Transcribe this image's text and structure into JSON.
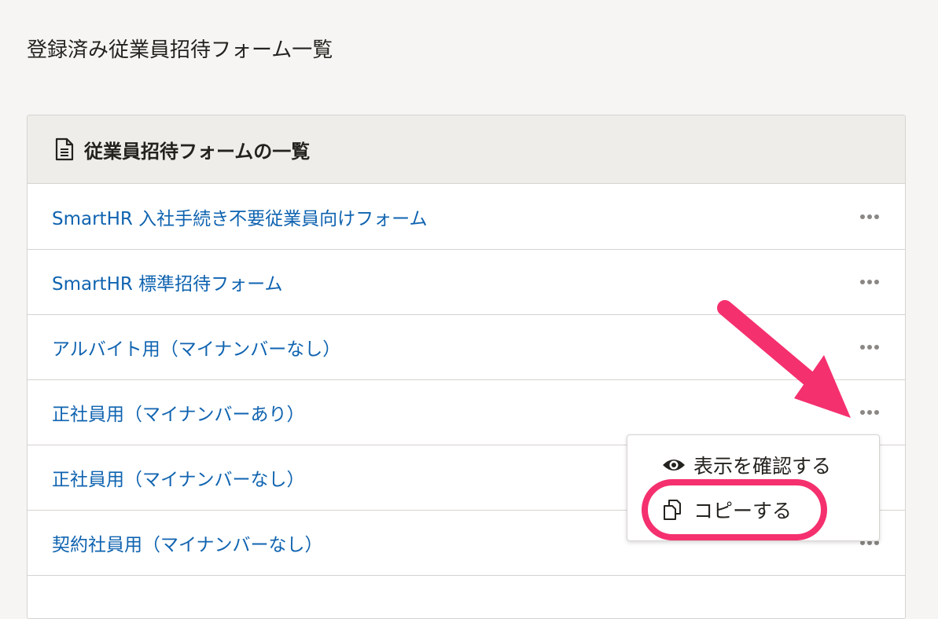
{
  "page": {
    "title": "登録済み従業員招待フォーム一覧"
  },
  "panel": {
    "title": "従業員招待フォームの一覧",
    "rows": [
      {
        "label": "SmartHR 入社手続き不要従業員向けフォーム"
      },
      {
        "label": "SmartHR 標準招待フォーム"
      },
      {
        "label": "アルバイト用（マイナンバーなし）"
      },
      {
        "label": "正社員用（マイナンバーあり）"
      },
      {
        "label": "正社員用（マイナンバーなし）"
      },
      {
        "label": "契約社員用（マイナンバーなし）"
      },
      {
        "label": ""
      }
    ]
  },
  "menu": {
    "view_label": "表示を確認する",
    "copy_label": "コピーする"
  },
  "colors": {
    "link": "#0f63b0",
    "annotation": "#f5306f",
    "background": "#f6f5f3"
  }
}
